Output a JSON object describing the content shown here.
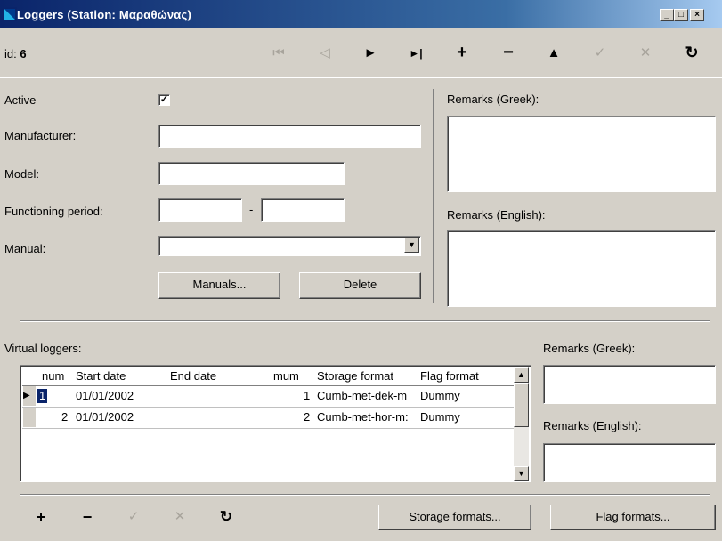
{
  "window": {
    "title": "Loggers (Station: Μαραθώνας)",
    "minimize": "_",
    "maximize": "□",
    "close": "×"
  },
  "record": {
    "id_label": "id:",
    "id_value": "6"
  },
  "navigator": {
    "first": "⏮",
    "prior": "◁",
    "next": "►",
    "last": "►|",
    "insert": "+",
    "delete": "−",
    "edit": "▲",
    "post": "✓",
    "cancel": "✕",
    "refresh": "↻"
  },
  "form": {
    "active_label": "Active",
    "active_checked": "✓",
    "manufacturer_label": "Manufacturer:",
    "manufacturer_value": "",
    "model_label": "Model:",
    "model_value": "",
    "functioning_period_label": "Functioning period:",
    "period_from": "",
    "period_separator": "-",
    "period_to": "",
    "manual_label": "Manual:",
    "manual_value": "",
    "manuals_button": "Manuals...",
    "delete_button": "Delete",
    "remarks_greek_label": "Remarks (Greek):",
    "remarks_english_label": "Remarks (English):"
  },
  "virtual_loggers": {
    "label": "Virtual loggers:",
    "columns": [
      "num",
      "Start date",
      "End date",
      "mum",
      "Storage format",
      "Flag format"
    ],
    "rows": [
      {
        "indicator": "▶",
        "num": "1",
        "start": "01/01/2002",
        "end": "",
        "mum": "1",
        "storage": "Cumb-met-dek-m",
        "flag": "Dummy"
      },
      {
        "indicator": "",
        "num": "2",
        "start": "01/01/2002",
        "end": "",
        "mum": "2",
        "storage": "Cumb-met-hor-m:",
        "flag": "Dummy"
      }
    ],
    "remarks_greek_label": "Remarks (Greek):",
    "remarks_english_label": "Remarks (English):"
  },
  "bottom_bar": {
    "insert": "+",
    "delete": "−",
    "post": "✓",
    "cancel": "✕",
    "refresh": "↻",
    "storage_formats_button": "Storage formats...",
    "flag_formats_button": "Flag formats..."
  }
}
